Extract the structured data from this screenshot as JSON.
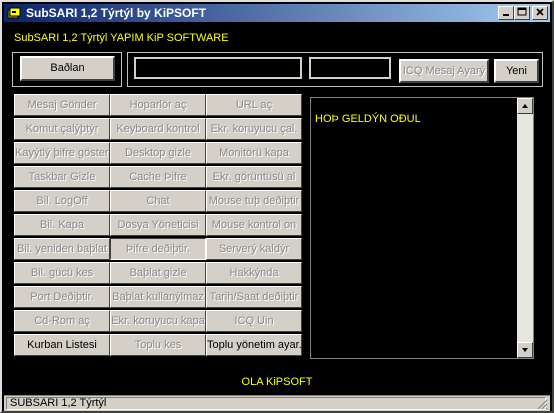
{
  "window": {
    "title": "SubSARI 1,2 Týrtýl by KiPSOFT"
  },
  "caption": "SubSARI 1,2 Týrtýl YAPIM KiP SOFTWARE",
  "top": {
    "connect_label": "Baðlan",
    "icq_label": "ICQ Mesaj Ayarý",
    "new_label": "Yeni"
  },
  "grid": [
    [
      "Mesaj Gönder",
      "Hoparlör aç",
      "URL aç"
    ],
    [
      "Komut çalýþtýr",
      "Keyboard kontrol",
      "Ekr. koruyucu çal."
    ],
    [
      "Kayýtlý þifre göster.",
      "Desktop gizle",
      "Monitörü kapa"
    ],
    [
      "Taskbar Gizle",
      "Cache Þifre",
      "Ekr. görüntüsü al"
    ],
    [
      "Bil. LogOff",
      "Chat",
      "Mouse tuþ deðiþtir"
    ],
    [
      "Bil. Kapa",
      "Dosya Yöneticisi",
      "Mouse kontrol on"
    ],
    [
      "Bil. yeniden baþlat",
      "Þifre deðiþtir.",
      "Serverý kaldýr"
    ],
    [
      "Bil. gücü kes",
      "Baþlat gizle",
      "Hakkýnda"
    ],
    [
      "Port Deðiþtir.",
      "Baþlat kullanýlmaz",
      "Tarih/Saat deðiþtir"
    ],
    [
      "Cd-Rom aç",
      "Ekr. koruyucu kapa",
      "ICQ Uin"
    ],
    [
      "Kurban Listesi",
      "Toplu kes",
      "Toplu yönetim ayar."
    ]
  ],
  "memo_text": "HOÞ GELDÝN OÐUL",
  "footer": "OLA KiPSOFT",
  "status": "SUBSARI 1,2 Týrtýl",
  "colors": {
    "accent": "#ffff00",
    "face": "#d4d0c8",
    "title_start": "#0a246a",
    "title_end": "#a6caf0"
  }
}
